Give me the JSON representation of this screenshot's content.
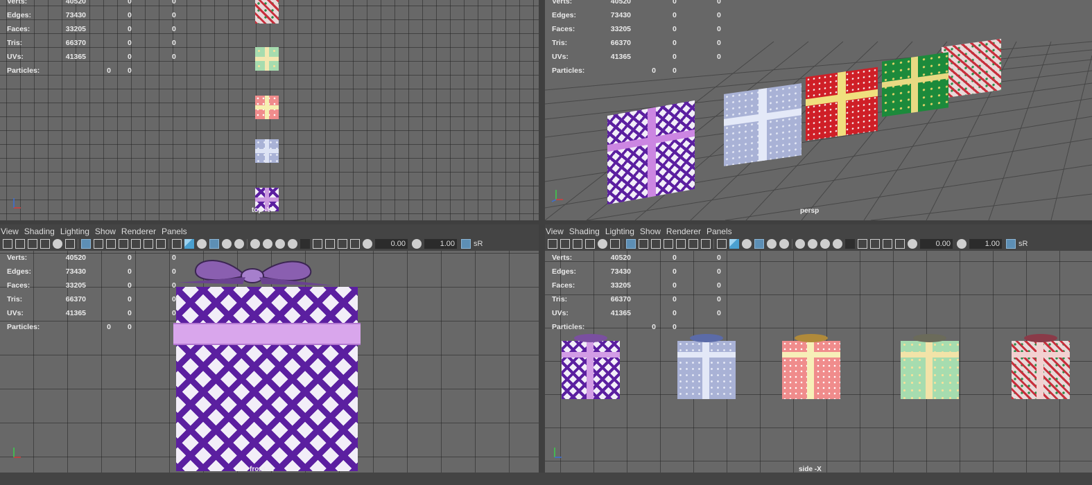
{
  "menu": [
    "View",
    "Shading",
    "Lighting",
    "Show",
    "Renderer",
    "Panels"
  ],
  "hud": {
    "rows": [
      {
        "label": "Verts:",
        "v1": "40520",
        "v2": "0",
        "v3": "0"
      },
      {
        "label": "Edges:",
        "v1": "73430",
        "v2": "0",
        "v3": "0"
      },
      {
        "label": "Faces:",
        "v1": "33205",
        "v2": "0",
        "v3": "0"
      },
      {
        "label": "Tris:",
        "v1": "66370",
        "v2": "0",
        "v3": "0"
      },
      {
        "label": "UVs:",
        "v1": "41365",
        "v2": "0",
        "v3": "0"
      }
    ],
    "particles": {
      "label": "Particles:",
      "v1": "0",
      "v2": "0"
    }
  },
  "toolbar": {
    "field_a": "0.00",
    "field_b": "1.00",
    "srgb": "sR"
  },
  "cameras": {
    "top": "top -Y",
    "persp": "persp",
    "front": "front -Z",
    "side": "side -X"
  },
  "axis_labels": {
    "x": "x",
    "y": "y",
    "z": "z"
  },
  "colors": {
    "viewport_bg": "#686868",
    "panel_bg": "#444444",
    "hud_text": "#eaeaea",
    "highlight": "#5d8fb5"
  }
}
